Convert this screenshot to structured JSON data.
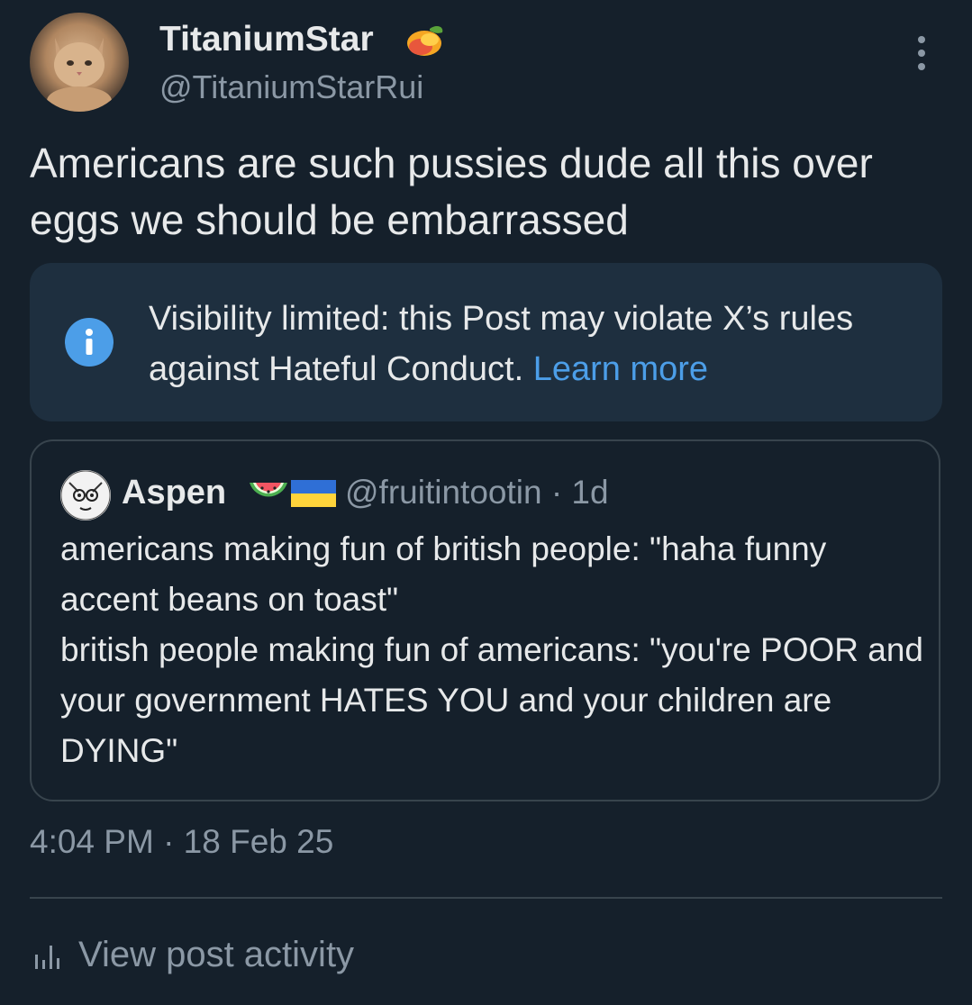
{
  "post": {
    "author": {
      "display_name": "TitaniumStar",
      "handle": "@TitaniumStarRui",
      "badge_icon": "mango-emoji-icon"
    },
    "text": "Americans are such pussies dude all this over eggs we should be embarrassed",
    "notice": {
      "text": "Visibility limited: this Post may violate X’s rules against Hateful Conduct.",
      "link": "Learn more",
      "icon": "info-icon"
    },
    "quoted": {
      "name": "Aspen",
      "emoji_icons": [
        "watermelon-icon",
        "ukraine-flag-icon"
      ],
      "handle_time": "@fruitintootin · 1d",
      "lines": [
        "americans making fun of british people: \"haha funny accent beans on toast\"",
        "british people making fun of americans: \"you're POOR and your government HATES YOU and your children are DYING\""
      ]
    },
    "timestamp": "4:04 PM · 18 Feb 25",
    "activity_label": "View post activity"
  },
  "colors": {
    "background": "#15202b",
    "text": "#e7e9ea",
    "secondary": "#8b98a5",
    "link": "#4c9ee8",
    "notice_bg": "#1e2f3f",
    "border": "#38444d"
  }
}
